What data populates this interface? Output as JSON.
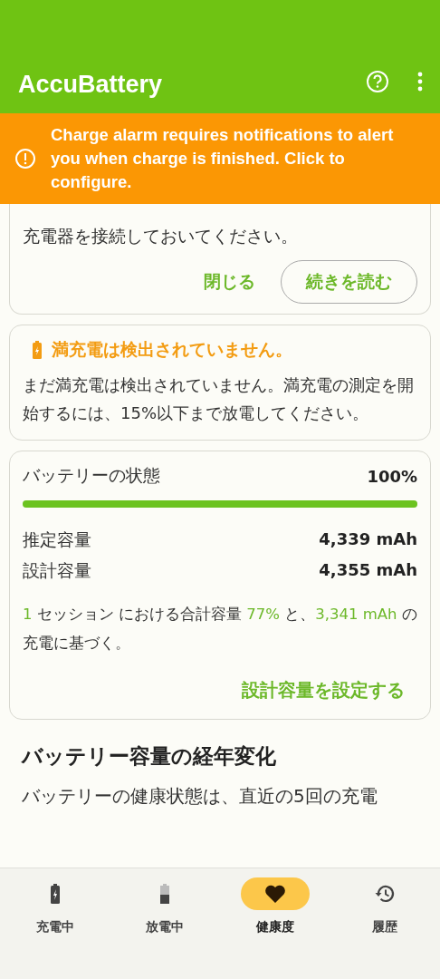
{
  "app_bar": {
    "title": "AccuBattery"
  },
  "banner": {
    "text": "Charge alarm requires notifications to alert you when charge is finished. Click to configure."
  },
  "tip_card": {
    "lines": [
      "充電器を接続しておいてください。"
    ],
    "buttons": [
      {
        "label": "閉じる",
        "kind": "text"
      },
      {
        "label": "続きを読む",
        "kind": "outlined"
      }
    ]
  },
  "notice_card": {
    "title": "満充電は検出されていません。",
    "body": "まだ満充電は検出されていません。満充電の測定を開始するには、15%以下まで放電してください。"
  },
  "health_card": {
    "label": "バッテリーの状態",
    "value": "100%",
    "level": 1.0,
    "rows": [
      {
        "label": "推定容量",
        "value": "4,339 mAh"
      },
      {
        "label": "設計容量",
        "value": "4,355 mAh"
      }
    ],
    "summary": [
      {
        "text": "1",
        "highlight": true
      },
      {
        "text": " セッション における合計容量 ",
        "highlight": false
      },
      {
        "text": "77%",
        "highlight": true
      },
      {
        "text": " と、",
        "highlight": false
      },
      {
        "text": "3,341 mAh",
        "highlight": true
      },
      {
        "text": " の充電に基づく。",
        "highlight": false
      }
    ],
    "action": "設計容量を設定する"
  },
  "section": {
    "title": "バッテリー容量の経年変化",
    "body": "バッテリーの健康状態は、直近の5回の充電"
  },
  "nav": [
    {
      "label": "充電中",
      "selected": false
    },
    {
      "label": "放電中",
      "selected": false
    },
    {
      "label": "健康度",
      "selected": true
    },
    {
      "label": "履歴",
      "selected": false
    }
  ]
}
